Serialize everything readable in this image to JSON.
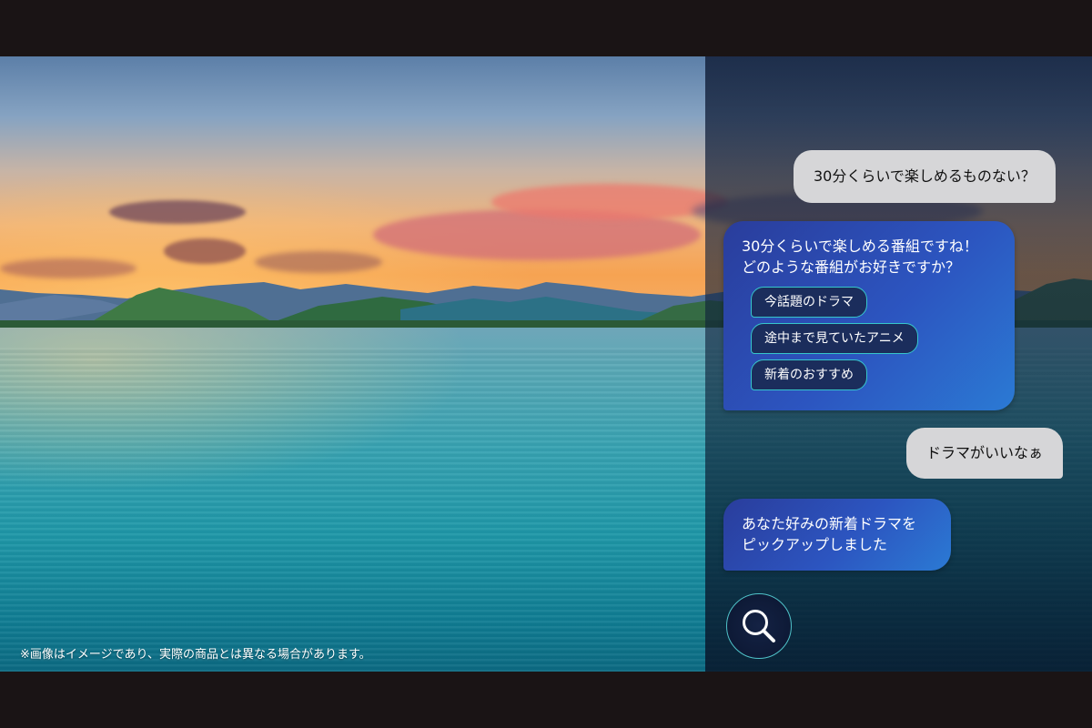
{
  "chat": {
    "messages": [
      {
        "role": "user",
        "text": "30分くらいで楽しめるものない？"
      },
      {
        "role": "assistant",
        "lines": [
          "30分くらいで楽しめる番組ですね！",
          "どのような番組がお好きですか？"
        ],
        "choices": [
          "今話題のドラマ",
          "途中まで見ていたアニメ",
          "新着のおすすめ"
        ]
      },
      {
        "role": "user",
        "text": "ドラマがいいなぁ"
      },
      {
        "role": "assistant",
        "lines": [
          "あなた好みの新着ドラマを",
          "ピックアップしました"
        ]
      }
    ]
  },
  "search_button": {
    "icon": "search-icon"
  },
  "disclaimer": "※画像はイメージであり、実際の商品とは異なる場合があります。",
  "colors": {
    "letterbox": "#1a1415",
    "user_bubble": "#d6d6d8",
    "assistant_bubble": "#2c55c0",
    "chip_border": "#36c6cc",
    "chip_fill": "#1b2d5c"
  }
}
